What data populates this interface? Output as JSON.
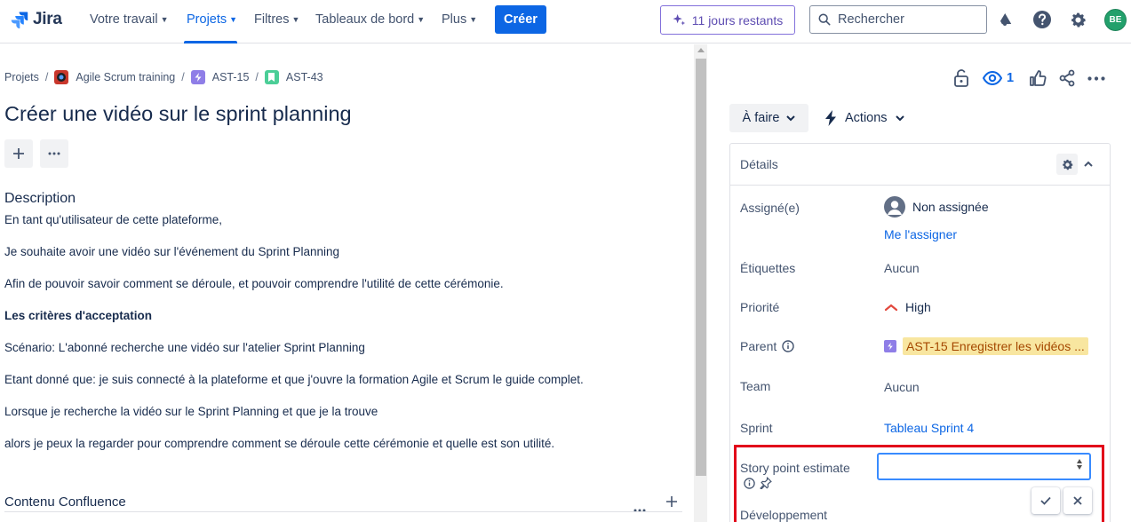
{
  "app": {
    "name": "Jira"
  },
  "nav": {
    "items": [
      {
        "label": "Votre travail",
        "active": false
      },
      {
        "label": "Projets",
        "active": true
      },
      {
        "label": "Filtres",
        "active": false
      },
      {
        "label": "Tableaux de bord",
        "active": false
      },
      {
        "label": "Plus",
        "active": false
      }
    ],
    "create_label": "Créer",
    "trial_label": "11 jours restants",
    "search_placeholder": "Rechercher",
    "avatar_initials": "BE"
  },
  "breadcrumb": [
    {
      "label": "Projets"
    },
    {
      "label": "Agile Scrum training"
    },
    {
      "label": "AST-15"
    },
    {
      "label": "AST-43"
    }
  ],
  "issue": {
    "title": "Créer une vidéo sur le sprint planning",
    "description_heading": "Description",
    "description": [
      "En tant qu'utilisateur de cette plateforme,",
      "Je souhaite avoir une vidéo sur l'événement du Sprint Planning",
      "Afin de pouvoir savoir comment se déroule, et pouvoir comprendre l'utilité de cette cérémonie.",
      "Les critères d'acceptation",
      "Scénario: L'abonné recherche une vidéo sur l'atelier Sprint Planning",
      "Etant donné que: je suis connecté à la plateforme et que j'ouvre la formation Agile et Scrum le guide complet.",
      "Lorsque je recherche la vidéo sur le Sprint Planning et que je la trouve",
      "alors je peux la regarder pour comprendre comment se déroule cette cérémonie et quelle est son utilité."
    ],
    "confluence_heading": "Contenu Confluence"
  },
  "side": {
    "watch_count": "1",
    "status_label": "À faire",
    "actions_label": "Actions",
    "details_title": "Détails",
    "fields": {
      "assignee_label": "Assigné(e)",
      "assignee_value": "Non assignée",
      "assign_me": "Me l'assigner",
      "labels_label": "Étiquettes",
      "labels_value": "Aucun",
      "priority_label": "Priorité",
      "priority_value": "High",
      "parent_label": "Parent",
      "parent_value": "AST-15 Enregistrer les vidéos ...",
      "team_label": "Team",
      "team_value": "Aucun",
      "sprint_label": "Sprint",
      "sprint_value": "Tableau Sprint 4",
      "story_points_label": "Story point estimate",
      "story_points_value": "",
      "development_label": "Développement"
    }
  },
  "colors": {
    "brand": "#0c66e4",
    "highlight": "#e2001a",
    "priority_high": "#e2483d",
    "parent_chip_bg": "#f8e6a0"
  }
}
